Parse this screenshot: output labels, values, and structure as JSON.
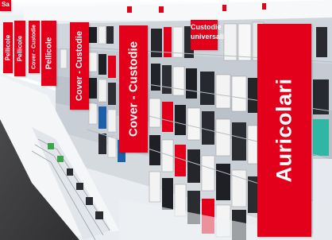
{
  "scene": {
    "description_colors": {
      "sign_red": "#e3001b",
      "sign_text": "#ffffff",
      "floor": "#3d3d3f",
      "shelf_white": "#f4f6f8",
      "peg_metal": "#c9ced4"
    }
  },
  "signs": {
    "corner_text": "Sa",
    "pellicole_1": "Pellicole",
    "pellicole_2": "Pellicole",
    "pellicole_3": "Pellicole",
    "cover_custodie_1": "Cover - Custodie",
    "cover_custodie_2": "Cover - Custodie",
    "custodie_universali_line1": "Custodie",
    "custodie_universali_line2": "universali",
    "auricolari": "Auricolari"
  }
}
